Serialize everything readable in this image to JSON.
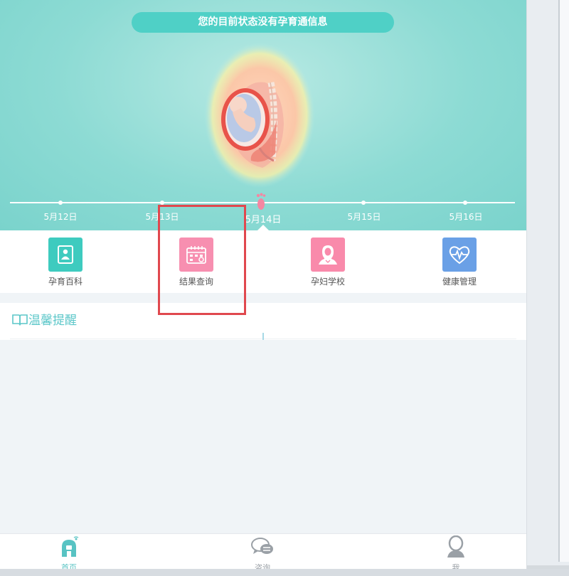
{
  "hero": {
    "status_text": "您的目前状态没有孕育通信息",
    "dates": [
      "5月12日",
      "5月13日",
      "5月14日",
      "5月15日",
      "5月16日"
    ],
    "current_date_index": 2
  },
  "features": [
    {
      "label": "孕育百科",
      "icon": "baby-icon",
      "color": "#3ecbbf"
    },
    {
      "label": "结果查询",
      "icon": "calendar-icon",
      "color": "#f78fb0"
    },
    {
      "label": "孕妇学校",
      "icon": "pregnant-woman-icon",
      "color": "#f98aab"
    },
    {
      "label": "健康管理",
      "icon": "heartbeat-icon",
      "color": "#6aa0e6"
    }
  ],
  "reminder": {
    "title": "温馨提醒",
    "icon": "book-icon"
  },
  "bottom_nav": {
    "items": [
      {
        "label": "首页",
        "icon": "home-icon",
        "active": true
      },
      {
        "label": "咨询",
        "icon": "chat-icon",
        "active": false
      },
      {
        "label": "我",
        "icon": "user-icon",
        "active": false
      }
    ]
  },
  "colors": {
    "accent": "#58c3c3",
    "hero_bg": "#8ddbd4",
    "highlight": "#e0484e"
  }
}
